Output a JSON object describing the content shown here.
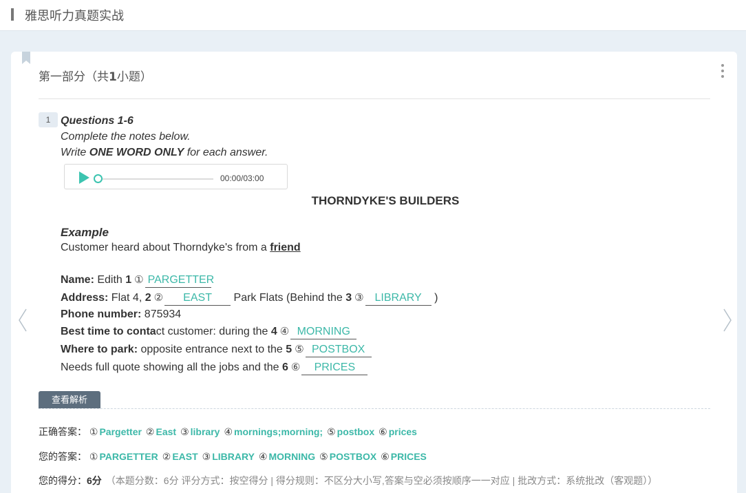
{
  "header": {
    "title": "雅思听力真题实战"
  },
  "section": {
    "title_prefix": "第一部分（共",
    "count": "1",
    "title_suffix": "小题）"
  },
  "question": {
    "number": "1",
    "heading": "Questions 1-6",
    "instruction1": "Complete the notes below.",
    "instruction2_pre": "Write ",
    "instruction2_bold": "ONE WORD ONLY",
    "instruction2_post": " for each answer."
  },
  "audio": {
    "time": "00:00/03:00",
    "progress": 0
  },
  "notes": {
    "title": "THORNDYKE'S BUILDERS",
    "example_label": "Example",
    "example_text": "Customer heard about Thorndyke's from a ",
    "example_answer": "friend",
    "lines": {
      "name_label": "Name:",
      "name_text": " Edith ",
      "name_num": "1",
      "name_circ": "①",
      "name_ans": "PARGETTER",
      "address_label": "Address:",
      "address_text": " Flat 4, ",
      "address_num": "2",
      "address_circ": "②",
      "address_ans": "EAST",
      "address_mid": " Park Flats (Behind the ",
      "address_num2": "3",
      "address_circ2": "③",
      "address_ans2": "LIBRARY",
      "address_end": " )",
      "phone_label": "Phone number:",
      "phone_text": " 875934",
      "contact_label": "Best time to conta",
      "contact_text": "ct customer: during the ",
      "contact_num": "4",
      "contact_circ": "④",
      "contact_ans": "MORNING",
      "park_label": "Where to park:",
      "park_text": " opposite entrance next to the ",
      "park_num": "5",
      "park_circ": "⑤",
      "park_ans": "POSTBOX",
      "quote_text": "Needs full quote showing all the jobs and the ",
      "quote_num": "6",
      "quote_circ": "⑥",
      "quote_ans": "PRICES"
    }
  },
  "analysis": {
    "button_label": "查看解析",
    "correct_label": "正确答案：",
    "correct": [
      {
        "c": "①",
        "v": "Pargetter"
      },
      {
        "c": "②",
        "v": "East"
      },
      {
        "c": "③",
        "v": "library"
      },
      {
        "c": "④",
        "v": "mornings;morning;"
      },
      {
        "c": "⑤",
        "v": "postbox"
      },
      {
        "c": "⑥",
        "v": "prices"
      }
    ],
    "yours_label": "您的答案：",
    "yours": [
      {
        "c": "①",
        "v": "PARGETTER"
      },
      {
        "c": "②",
        "v": "EAST"
      },
      {
        "c": "③",
        "v": "LIBRARY"
      },
      {
        "c": "④",
        "v": "MORNING"
      },
      {
        "c": "⑤",
        "v": "POSTBOX"
      },
      {
        "c": "⑥",
        "v": "PRICES"
      }
    ],
    "score_label": "您的得分：",
    "score_value": "6分",
    "score_detail": "（本题分数：6分 评分方式：按空得分 | 得分规则：不区分大小写,答案与空必须按顺序一一对应 | 批改方式：系统批改（客观题））"
  },
  "colors": {
    "accent": "#3cb8a8",
    "button": "#5d6e7e"
  }
}
